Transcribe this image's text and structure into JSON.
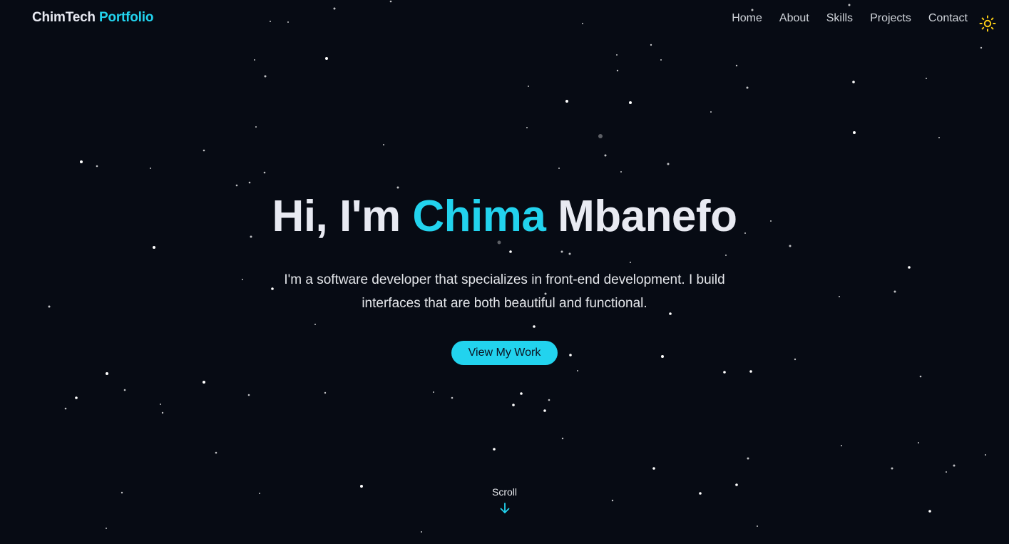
{
  "colors": {
    "background": "#070b14",
    "accent": "#22d3ee",
    "text": "#e8eaf2",
    "sun_icon": "#facc15"
  },
  "navbar": {
    "logo_primary": "ChimTech",
    "logo_accent": "Portfolio",
    "links": [
      {
        "label": "Home"
      },
      {
        "label": "About"
      },
      {
        "label": "Skills"
      },
      {
        "label": "Projects"
      },
      {
        "label": "Contact"
      }
    ],
    "theme_toggle_icon": "sun-icon"
  },
  "hero": {
    "title_prefix": "Hi, I'm",
    "title_accent": "Chima",
    "title_suffix": "Mbanefo",
    "description": "I'm a software developer that specializes in front-end development. I build interfaces that are both beautiful and functional.",
    "cta_label": "View My Work"
  },
  "scroll": {
    "label": "Scroll",
    "icon": "arrow-down-icon"
  },
  "background": {
    "decoration": "starfield"
  }
}
